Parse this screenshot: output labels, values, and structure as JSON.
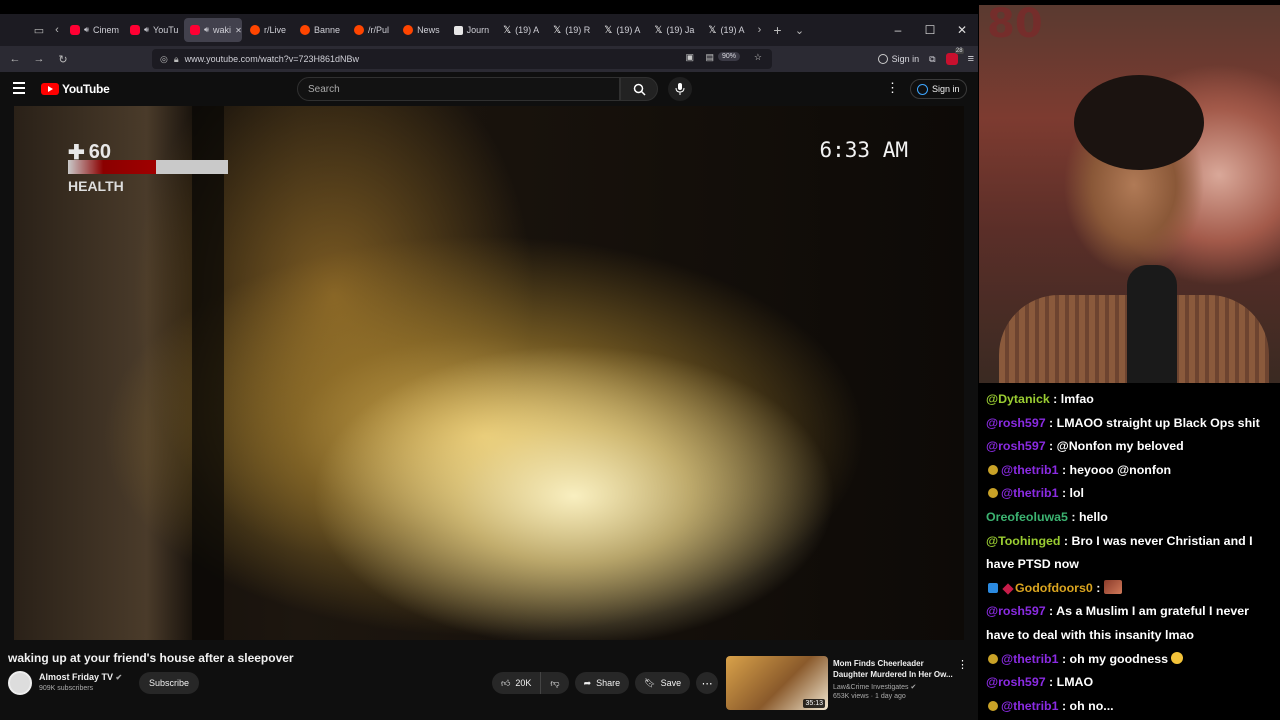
{
  "browser": {
    "tabs": [
      {
        "label": "Cinem",
        "icon": "youtube-icon",
        "active": false
      },
      {
        "label": "YouTu",
        "icon": "youtube-icon",
        "active": false
      },
      {
        "label": "waki",
        "icon": "youtube-icon",
        "active": true
      },
      {
        "label": "r/Live",
        "icon": "reddit-icon",
        "active": false
      },
      {
        "label": "Banne",
        "icon": "reddit-icon",
        "active": false
      },
      {
        "label": "/r/Pul",
        "icon": "reddit-icon",
        "active": false
      },
      {
        "label": "News",
        "icon": "reddit-icon",
        "active": false
      },
      {
        "label": "Journ",
        "icon": "ap-icon",
        "active": false
      },
      {
        "label": "(19) A",
        "icon": "x-icon",
        "active": false
      },
      {
        "label": "(19) R",
        "icon": "x-icon",
        "active": false
      },
      {
        "label": "(19) A",
        "icon": "x-icon",
        "active": false
      },
      {
        "label": "(19) Ja",
        "icon": "x-icon",
        "active": false
      },
      {
        "label": "(19) A",
        "icon": "x-icon",
        "active": false
      }
    ],
    "url": "www.youtube.com/watch?v=723H861dNBw",
    "zoom": "90%",
    "signin_label": "Sign in",
    "extension_badge": "28"
  },
  "youtube": {
    "logo_text": "YouTube",
    "search_placeholder": "Search",
    "signin_label": "Sign in",
    "video": {
      "hud_health_value": "60",
      "hud_health_label": "HEALTH",
      "hud_health_fraction": 0.55,
      "hud_time": "6:33 AM"
    },
    "title": "waking up at your friend's house after a sleepover",
    "channel": {
      "name": "Almost Friday TV",
      "subscribers": "909K subscribers",
      "subscribe_label": "Subscribe"
    },
    "actions": {
      "likes": "20K",
      "share_label": "Share",
      "save_label": "Save"
    },
    "recommendation": {
      "title": "Mom Finds Cheerleader Daughter Murdered In Her Ow...",
      "channel": "Law&Crime Investigates",
      "meta": "653K views · 1 day ago",
      "duration": "35:13"
    }
  },
  "overlay": {
    "score_text": "80"
  },
  "chat": [
    {
      "user": "@Dytanick",
      "color": "#9acd32",
      "badges": [],
      "text": "lmfao"
    },
    {
      "user": "@rosh597",
      "color": "#8a2be2",
      "badges": [],
      "text": "LMAOO straight up Black Ops shit"
    },
    {
      "user": "@rosh597",
      "color": "#8a2be2",
      "badges": [],
      "text": "@Nonfon my beloved"
    },
    {
      "user": "@thetrib1",
      "color": "#8a2be2",
      "badges": [
        "star"
      ],
      "text": "heyooo @nonfon"
    },
    {
      "user": "@thetrib1",
      "color": "#8a2be2",
      "badges": [
        "star"
      ],
      "text": "lol"
    },
    {
      "user": "Oreofeoluwa5",
      "color": "#3cb371",
      "badges": [],
      "text": "hello"
    },
    {
      "user": "@Toohinged",
      "color": "#9acd32",
      "badges": [],
      "text": "Bro I was never Christian and I have PTSD now"
    },
    {
      "user": "Godofdoors0",
      "color": "#daa520",
      "badges": [
        "prime",
        "gem"
      ],
      "text": "",
      "emote": "box"
    },
    {
      "user": "@rosh597",
      "color": "#8a2be2",
      "badges": [],
      "text": "As a Muslim I am grateful I never have to deal with this insanity lmao"
    },
    {
      "user": "@thetrib1",
      "color": "#8a2be2",
      "badges": [
        "star"
      ],
      "text": "oh my goodness",
      "emote": "face"
    },
    {
      "user": "@rosh597",
      "color": "#8a2be2",
      "badges": [],
      "text": "LMAO"
    },
    {
      "user": "@thetrib1",
      "color": "#8a2be2",
      "badges": [
        "star"
      ],
      "text": "oh no..."
    }
  ]
}
